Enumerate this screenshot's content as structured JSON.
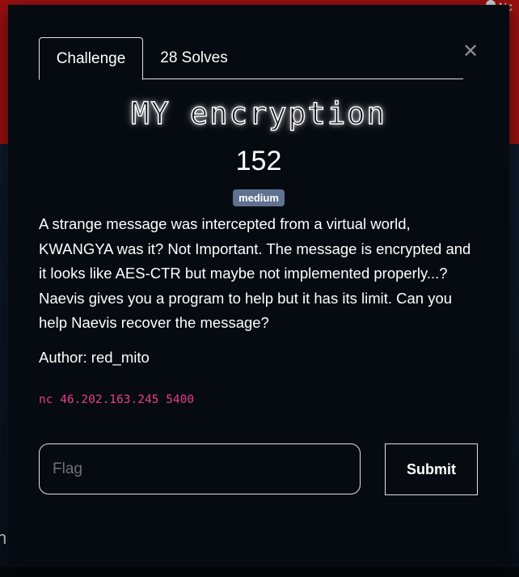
{
  "background": {
    "corner_text": "Nc",
    "left_glyph": "n"
  },
  "modal": {
    "tabs": [
      {
        "label": "Challenge",
        "active": true
      },
      {
        "label": "28 Solves",
        "active": false
      }
    ],
    "close_icon": "close-icon",
    "title": "MY encryption",
    "points": "152",
    "difficulty_badge": "medium",
    "description": "A strange message was intercepted from a virtual world, KWANGYA was it? Not Important. The message is encrypted and it looks like AES-CTR but maybe not implemented properly...? Naevis gives you a program to help but it has its limit. Can you help Naevis recover the message?",
    "author": "Author: red_mito",
    "connection": "nc 46.202.163.245 5400",
    "flag_input": {
      "placeholder": "Flag",
      "value": ""
    },
    "submit_label": "Submit"
  },
  "colors": {
    "background_red": "#9b0f10",
    "modal_bg": "#060a11",
    "badge_bg": "#5f7390",
    "code_pink": "#e83e8c"
  }
}
